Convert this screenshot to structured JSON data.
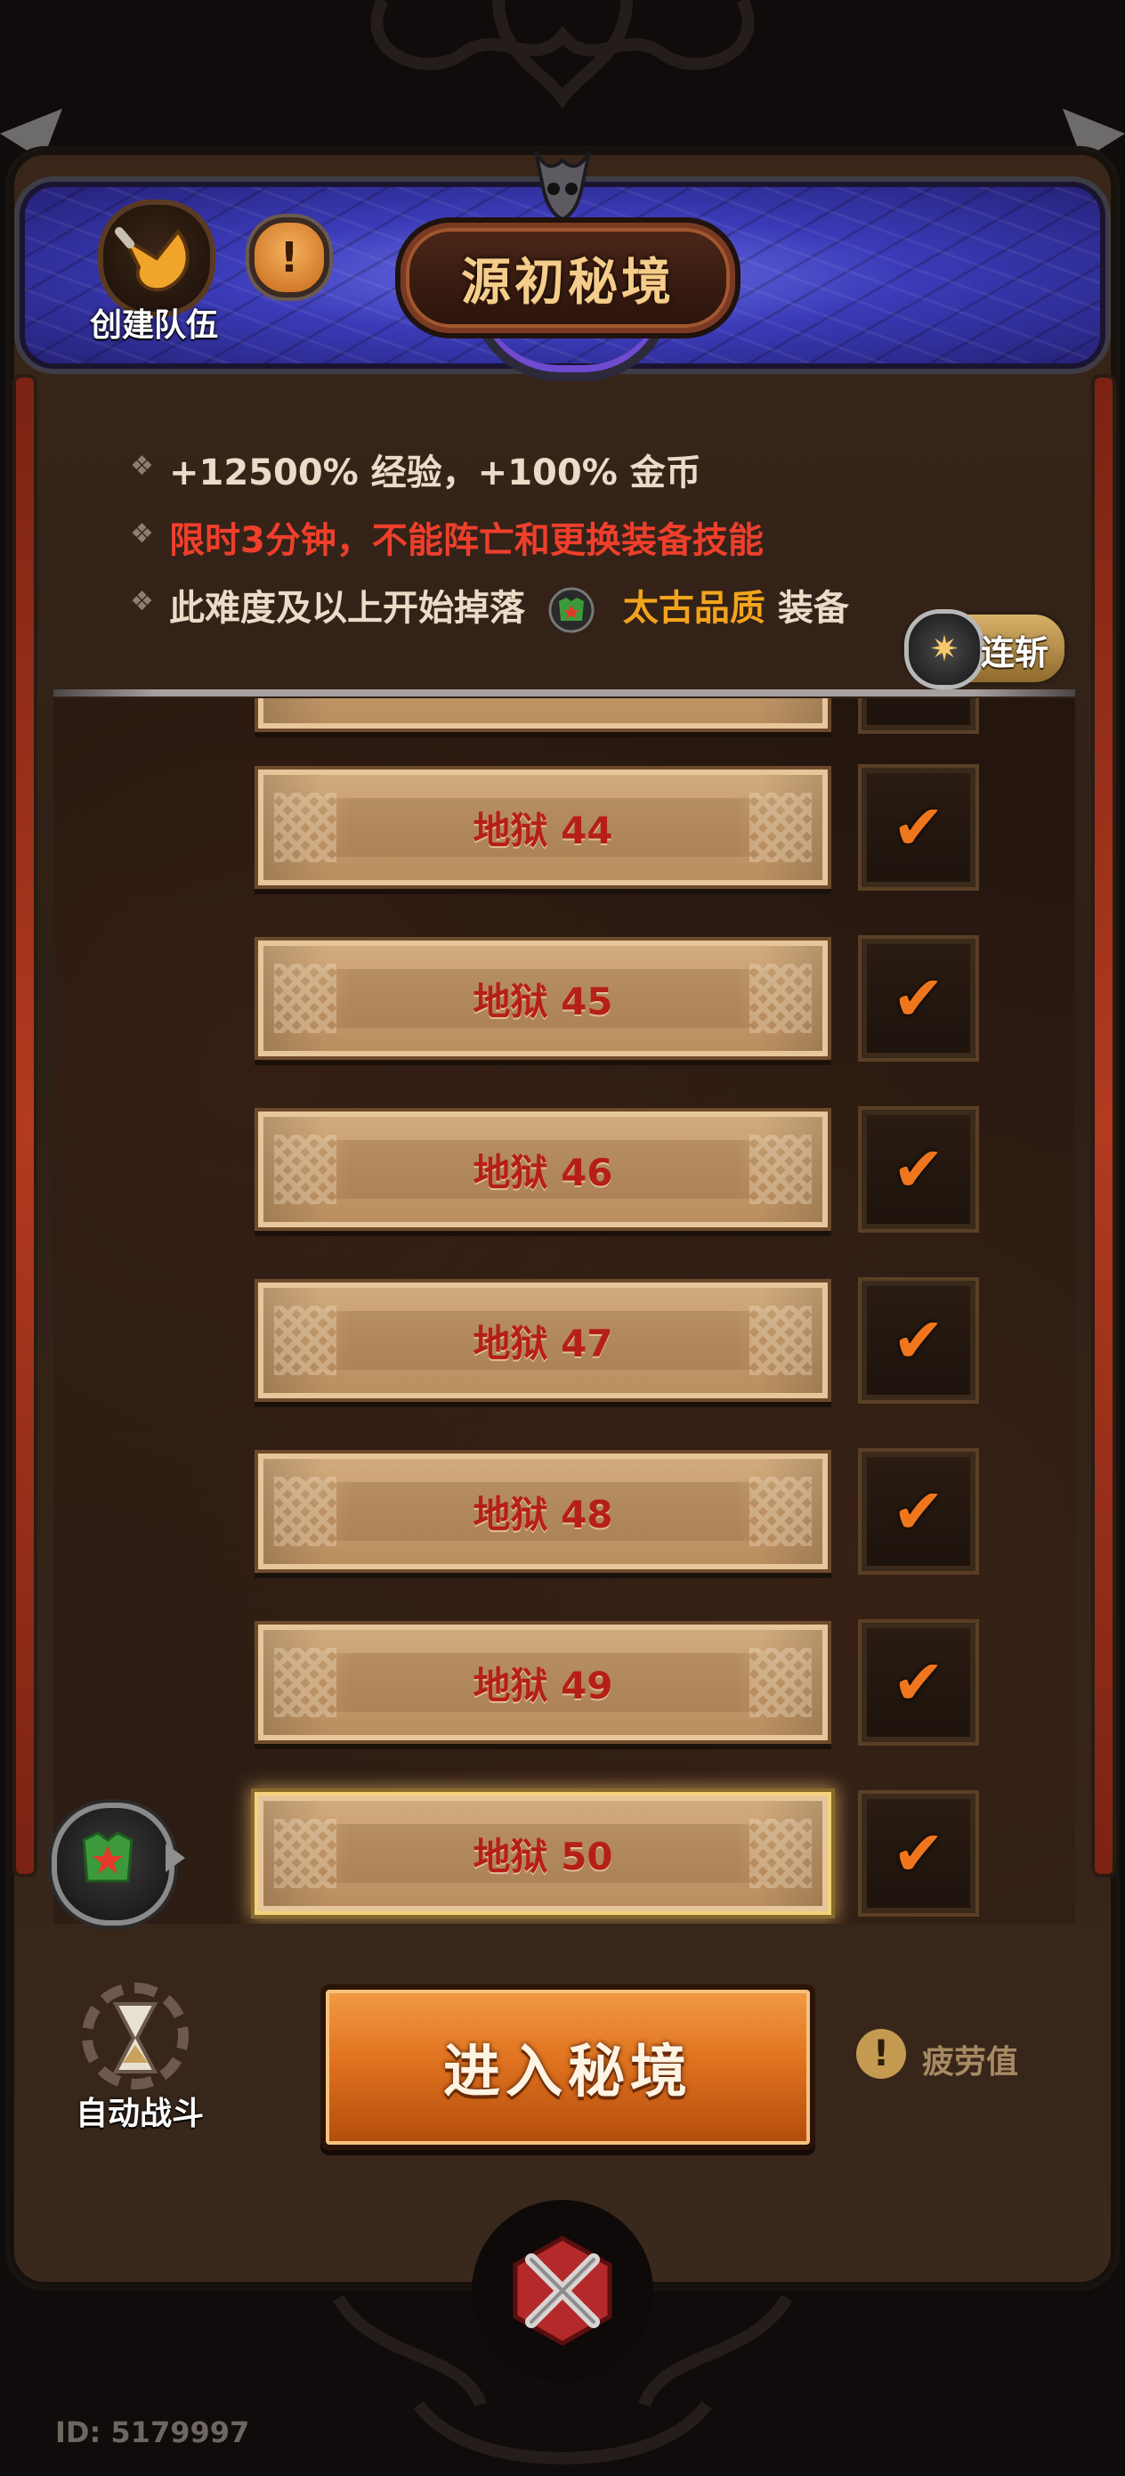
{
  "header": {
    "title": "源初秘境",
    "create_team_label": "创建队伍",
    "info_icon": "exclamation-icon"
  },
  "info_lines": {
    "line1": "+12500% 经验，+100% 金币",
    "line2": "限时3分钟，不能阵亡和更换装备技能",
    "line3_prefix": "此难度及以上开始掉落",
    "line3_quality": "太古品质",
    "line3_suffix": "装备"
  },
  "chain_button": {
    "label": "连斩",
    "icon": "star-burst-icon"
  },
  "levels": [
    {
      "label": "",
      "checked": true
    },
    {
      "label": "地狱 44",
      "checked": true
    },
    {
      "label": "地狱 45",
      "checked": true
    },
    {
      "label": "地狱 46",
      "checked": true
    },
    {
      "label": "地狱 47",
      "checked": true
    },
    {
      "label": "地狱 48",
      "checked": true
    },
    {
      "label": "地狱 49",
      "checked": true
    },
    {
      "label": "地狱 50",
      "checked": true,
      "selected": true
    }
  ],
  "controls": {
    "auto_battle_label": "自动战斗",
    "enter_label": "进入秘境",
    "fatigue_label": "疲劳值"
  },
  "footer": {
    "user_id": "ID: 5179997"
  },
  "colors": {
    "warning_red": "#ef3f2c",
    "quality_gold": "#f2a41c",
    "check_orange": "#f0761e",
    "enter_orange": "#e0731f",
    "banner_blue": "#3b3bb8"
  }
}
